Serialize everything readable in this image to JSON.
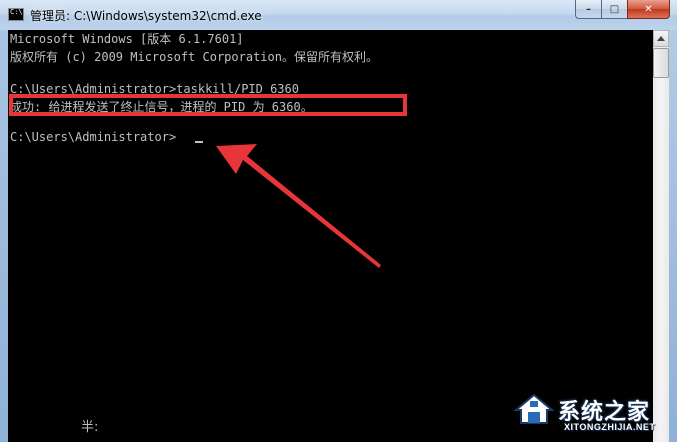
{
  "window": {
    "title": "管理员: C:\\Windows\\system32\\cmd.exe",
    "buttons": {
      "minimize": "–",
      "maximize": "□",
      "close": "✕"
    }
  },
  "console": {
    "lines": [
      "Microsoft Windows [版本 6.1.7601]",
      "版权所有 (c) 2009 Microsoft Corporation。保留所有权利。",
      "",
      "C:\\Users\\Administrator>taskkill/PID 6360",
      "成功: 给进程发送了终止信号，进程的 PID 为 6360。",
      "",
      "C:\\Users\\Administrator>"
    ],
    "ime_status": "半:"
  },
  "watermark": {
    "name": "系统之家",
    "url": "XITONGZHIJIA.NET"
  },
  "colors": {
    "console_bg": "#000000",
    "console_text": "#c0c0c0",
    "annotation_red": "#e8353a"
  },
  "icons": {
    "app": "cmd-icon",
    "scroll_up": "scroll-up-arrow-icon",
    "annotation": "red-arrow-icon"
  }
}
